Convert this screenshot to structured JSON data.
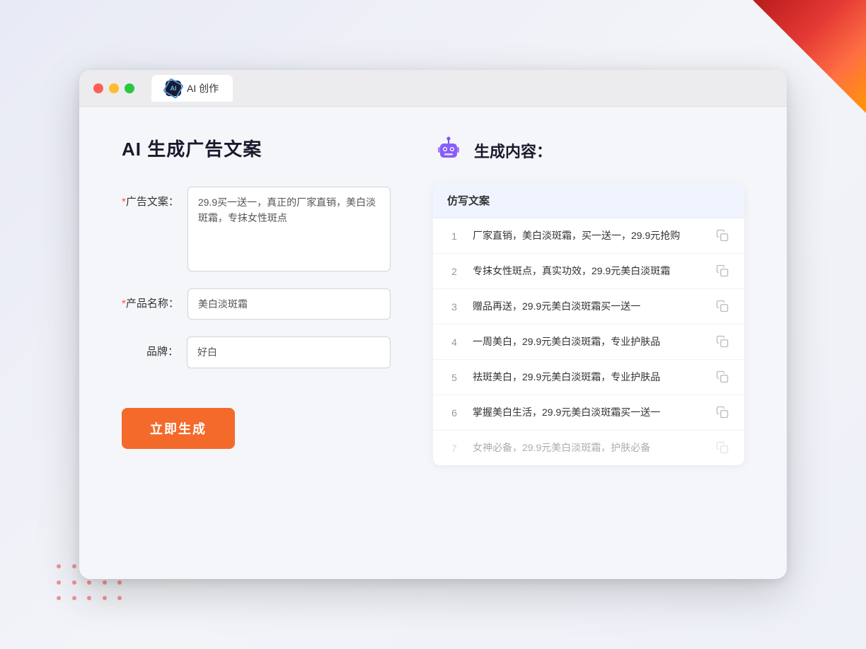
{
  "window": {
    "controls": {
      "close_label": "",
      "min_label": "",
      "max_label": ""
    },
    "tab": {
      "icon_text": "AI",
      "label": "AI 创作"
    }
  },
  "left_panel": {
    "title": "AI 生成广告文案",
    "form": {
      "ad_copy_label": "广告文案：",
      "ad_copy_required": "*",
      "ad_copy_value": "29.9买一送一，真正的厂家直销，美白淡斑霜，专抹女性斑点",
      "product_name_label": "产品名称：",
      "product_name_required": "*",
      "product_name_value": "美白淡斑霜",
      "brand_label": "品牌：",
      "brand_value": "好白"
    },
    "generate_button": "立即生成"
  },
  "right_panel": {
    "title": "生成内容：",
    "table_header": "仿写文案",
    "results": [
      {
        "num": "1",
        "text": "厂家直销，美白淡斑霜，买一送一，29.9元抢购"
      },
      {
        "num": "2",
        "text": "专抹女性斑点，真实功效，29.9元美白淡斑霜"
      },
      {
        "num": "3",
        "text": "赠品再送，29.9元美白淡斑霜买一送一"
      },
      {
        "num": "4",
        "text": "一周美白，29.9元美白淡斑霜，专业护肤品"
      },
      {
        "num": "5",
        "text": "祛斑美白，29.9元美白淡斑霜，专业护肤品"
      },
      {
        "num": "6",
        "text": "掌握美白生活，29.9元美白淡斑霜买一送一"
      },
      {
        "num": "7",
        "text": "女神必备，29.9元美白淡斑霜，护肤必备",
        "faded": true
      }
    ]
  }
}
